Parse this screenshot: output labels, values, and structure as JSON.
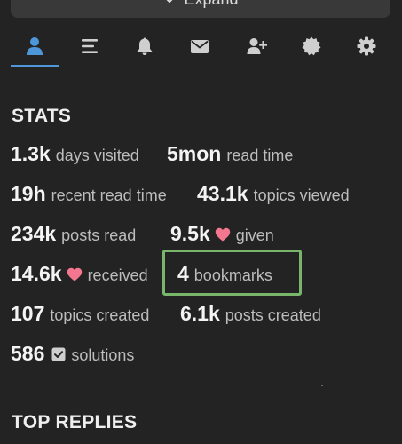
{
  "expand": {
    "label": "Expand",
    "icon": "chevron-down-icon"
  },
  "nav_tabs": [
    {
      "name": "tab-summary",
      "icon": "user-icon",
      "active": true
    },
    {
      "name": "tab-activity",
      "icon": "list-icon",
      "active": false
    },
    {
      "name": "tab-notifications",
      "icon": "bell-icon",
      "active": false
    },
    {
      "name": "tab-messages",
      "icon": "envelope-icon",
      "active": false
    },
    {
      "name": "tab-invites",
      "icon": "user-plus-icon",
      "active": false
    },
    {
      "name": "tab-badges",
      "icon": "certificate-icon",
      "active": false
    },
    {
      "name": "tab-preferences",
      "icon": "gear-icon",
      "active": false
    }
  ],
  "stats": {
    "title": "STATS",
    "items": [
      {
        "value": "1.3k",
        "label": "days visited"
      },
      {
        "value": "5mon",
        "label": "read time"
      },
      {
        "value": "19h",
        "label": "recent read time"
      },
      {
        "value": "43.1k",
        "label": "topics viewed"
      },
      {
        "value": "234k",
        "label": "posts read"
      },
      {
        "value": "9.5k",
        "label": "given",
        "icon": "heart-icon"
      },
      {
        "value": "14.6k",
        "label": "received",
        "icon": "heart-icon"
      },
      {
        "value": "4",
        "label": "bookmarks"
      },
      {
        "value": "107",
        "label": "topics created"
      },
      {
        "value": "6.1k",
        "label": "posts created"
      },
      {
        "value": "586",
        "label": "solutions",
        "icon": "check-square-icon"
      }
    ]
  },
  "top_replies": {
    "title": "TOP REPLIES"
  },
  "colors": {
    "background": "#232323",
    "accent": "#4d97d8",
    "heart": "#f2778f",
    "highlight": "#79b66c",
    "icon": "#cfcfcf"
  }
}
